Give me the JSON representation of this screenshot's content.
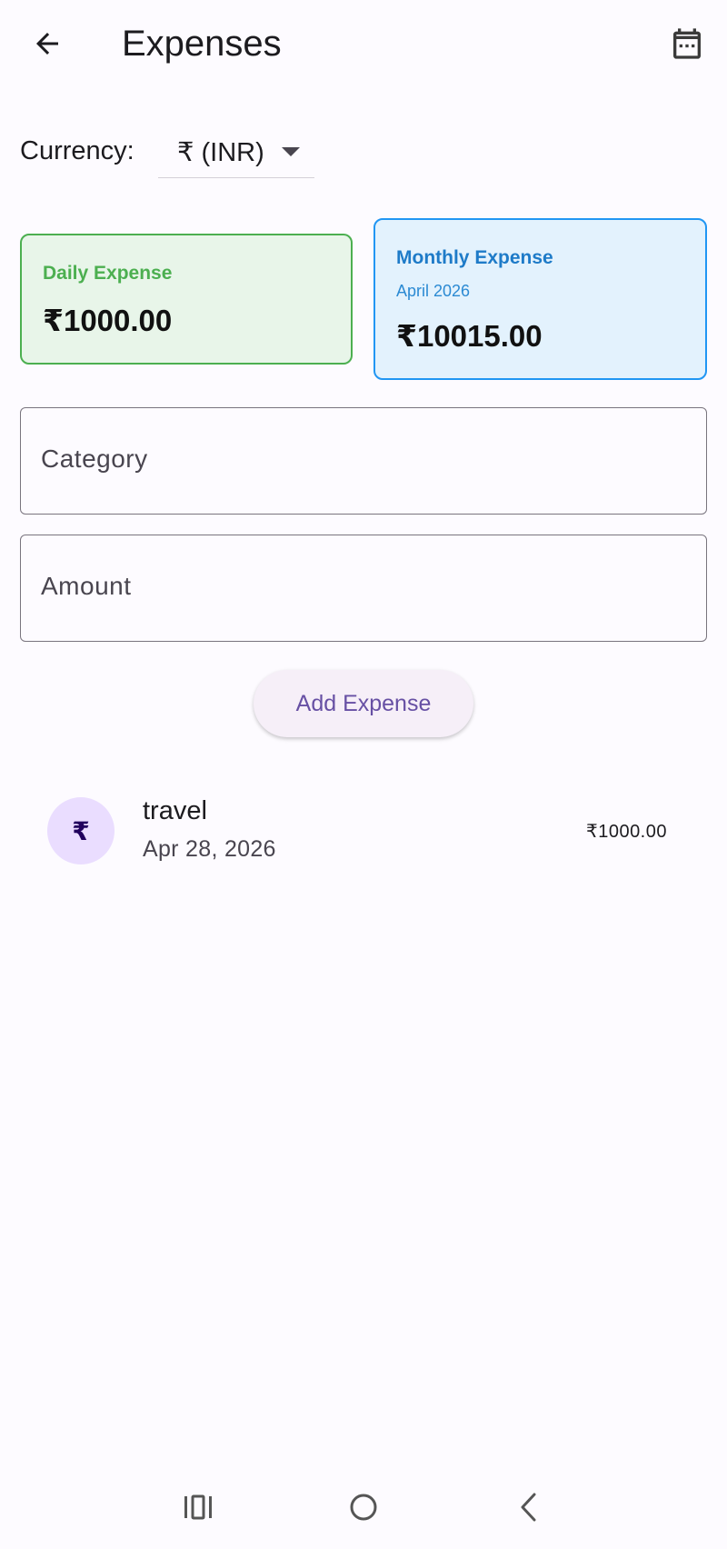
{
  "app_bar": {
    "title": "Expenses",
    "back_icon": "arrow-back-icon",
    "calendar_icon": "calendar-icon"
  },
  "currency": {
    "label": "Currency:",
    "selected": "₹ (INR)"
  },
  "daily_card": {
    "label": "Daily Expense",
    "amount": "₹1000.00",
    "accent": "#4caf50",
    "background": "#e8f5e9"
  },
  "monthly_card": {
    "label": "Monthly Expense",
    "month": "April 2026",
    "amount": "₹10015.00",
    "accent": "#2196f3",
    "background": "#e3f2fd"
  },
  "form": {
    "category_placeholder": "Category",
    "amount_placeholder": "Amount",
    "add_button_label": "Add Expense"
  },
  "expenses": [
    {
      "avatar_symbol": "₹",
      "category": "travel",
      "date": "Apr 28, 2026",
      "amount": "₹1000.00"
    }
  ],
  "nav_bar": {
    "recents_icon": "recents-icon",
    "home_icon": "home-icon",
    "back_icon": "nav-back-icon"
  }
}
